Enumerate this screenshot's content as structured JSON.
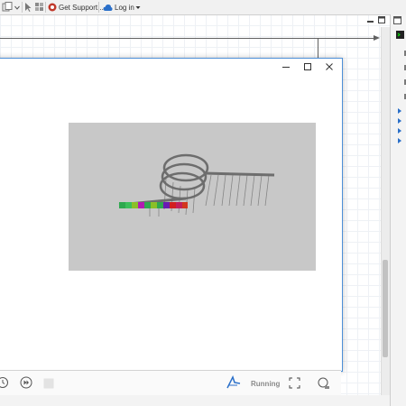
{
  "toolbar": {
    "get_support_label": "Get Support...",
    "login_label": "Log in"
  },
  "sim_window": {
    "status": "Running"
  },
  "colors": {
    "window_border": "#4d8fd8",
    "sim_background": "#c8c8c8",
    "accent_blue": "#2a6fc9"
  },
  "icons": {
    "minimize": "minimize-icon",
    "maximize": "maximize-icon",
    "close": "close-icon",
    "reset": "reset-icon",
    "step": "step-icon",
    "stop": "stop-icon",
    "run_mode": "run-mode-icon",
    "fullscreen": "fullscreen-icon",
    "camera": "camera-icon"
  }
}
